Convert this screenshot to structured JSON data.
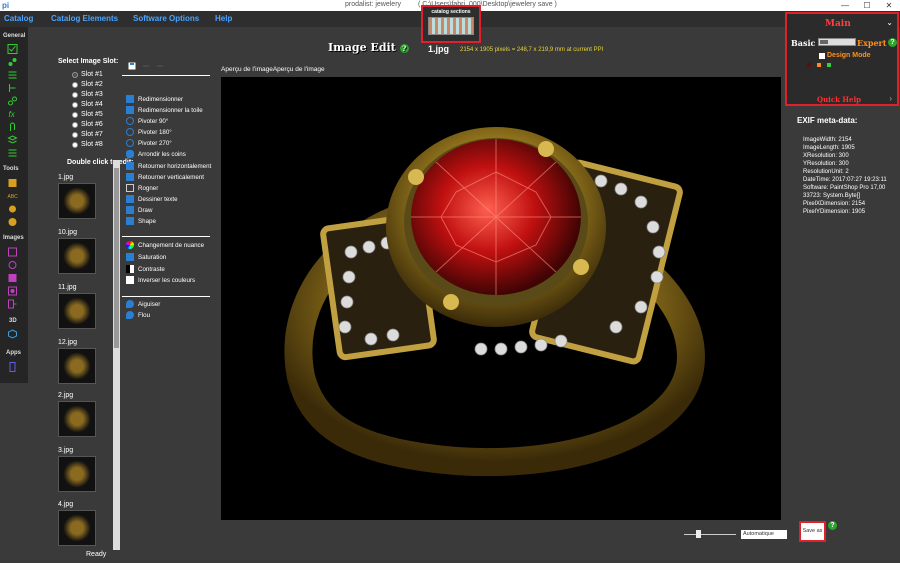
{
  "window": {
    "logo": "pi",
    "title": "prodalist: jewelery",
    "path": "( C:\\Users\\fabri_000\\Desktop\\jewelery save )",
    "controls": [
      "—",
      "☐",
      "✕"
    ]
  },
  "menu": [
    "Catalog",
    "Catalog Elements",
    "Software Options",
    "Help"
  ],
  "catalog_sections": {
    "label": "catalog sections"
  },
  "sidebar": {
    "sections": [
      "General",
      "Tools",
      "Images",
      "3D",
      "Apps"
    ]
  },
  "slots": {
    "title": "Select Image Slot:",
    "items": [
      "Slot #1",
      "Slot #2",
      "Slot #3",
      "Slot #4",
      "Slot #5",
      "Slot #6",
      "Slot #7",
      "Slot #8"
    ],
    "selected": 0
  },
  "thumbs": {
    "title": "Double click to edit:",
    "items": [
      "1.jpg",
      "10.jpg",
      "11.jpg",
      "12.jpg",
      "2.jpg",
      "3.jpg",
      "4.jpg"
    ]
  },
  "status": "Ready",
  "tools": {
    "group1": [
      "Redimensionner",
      "Redimensionner la toile",
      "Pivoter 90°",
      "Pivoter 180°",
      "Pivoter 270°",
      "Arrondir les coins",
      "Retourner horizontalement",
      "Retourner verticalement",
      "Rogner",
      "Dessiner texte",
      "Draw",
      "Shape"
    ],
    "group2": [
      "Changement de nuance",
      "Saturation",
      "Contraste",
      "Inverser les couleurs"
    ],
    "group3": [
      "Aiguiser",
      "Flou"
    ]
  },
  "editor": {
    "title": "Image Edit",
    "filename": "1.jpg",
    "dimensions": "2154 x 1905 pixels = 248,7 x 219,9 mm at current PPI",
    "preview_label": "Aperçu de l'imageAperçu de l'image",
    "zoom_mode": "Automatique"
  },
  "main_panel": {
    "title": "Main",
    "basic": "Basic",
    "expert": "Expert",
    "design_mode": "Design Mode",
    "quick_help": "Quick Help"
  },
  "exif": {
    "title": "EXIF meta-data:",
    "lines": [
      "ImageWidth: 2154",
      "ImageLength: 1905",
      "XResolution: 300",
      "YResolution: 300",
      "ResolutionUnit: 2",
      "DateTime: 2017:07:27 19:23:11",
      "Software: PaintShop Pro 17,00",
      "33723: System.Byte[]",
      "PixelXDimension: 2154",
      "PixelYDimension: 1905"
    ]
  },
  "save_button": "Save as",
  "help_glyph": "?",
  "colors": {
    "accent": "#4aa3ff",
    "highlight": "#e0202a",
    "expert": "#ff9020",
    "help": "#2aa62a"
  }
}
